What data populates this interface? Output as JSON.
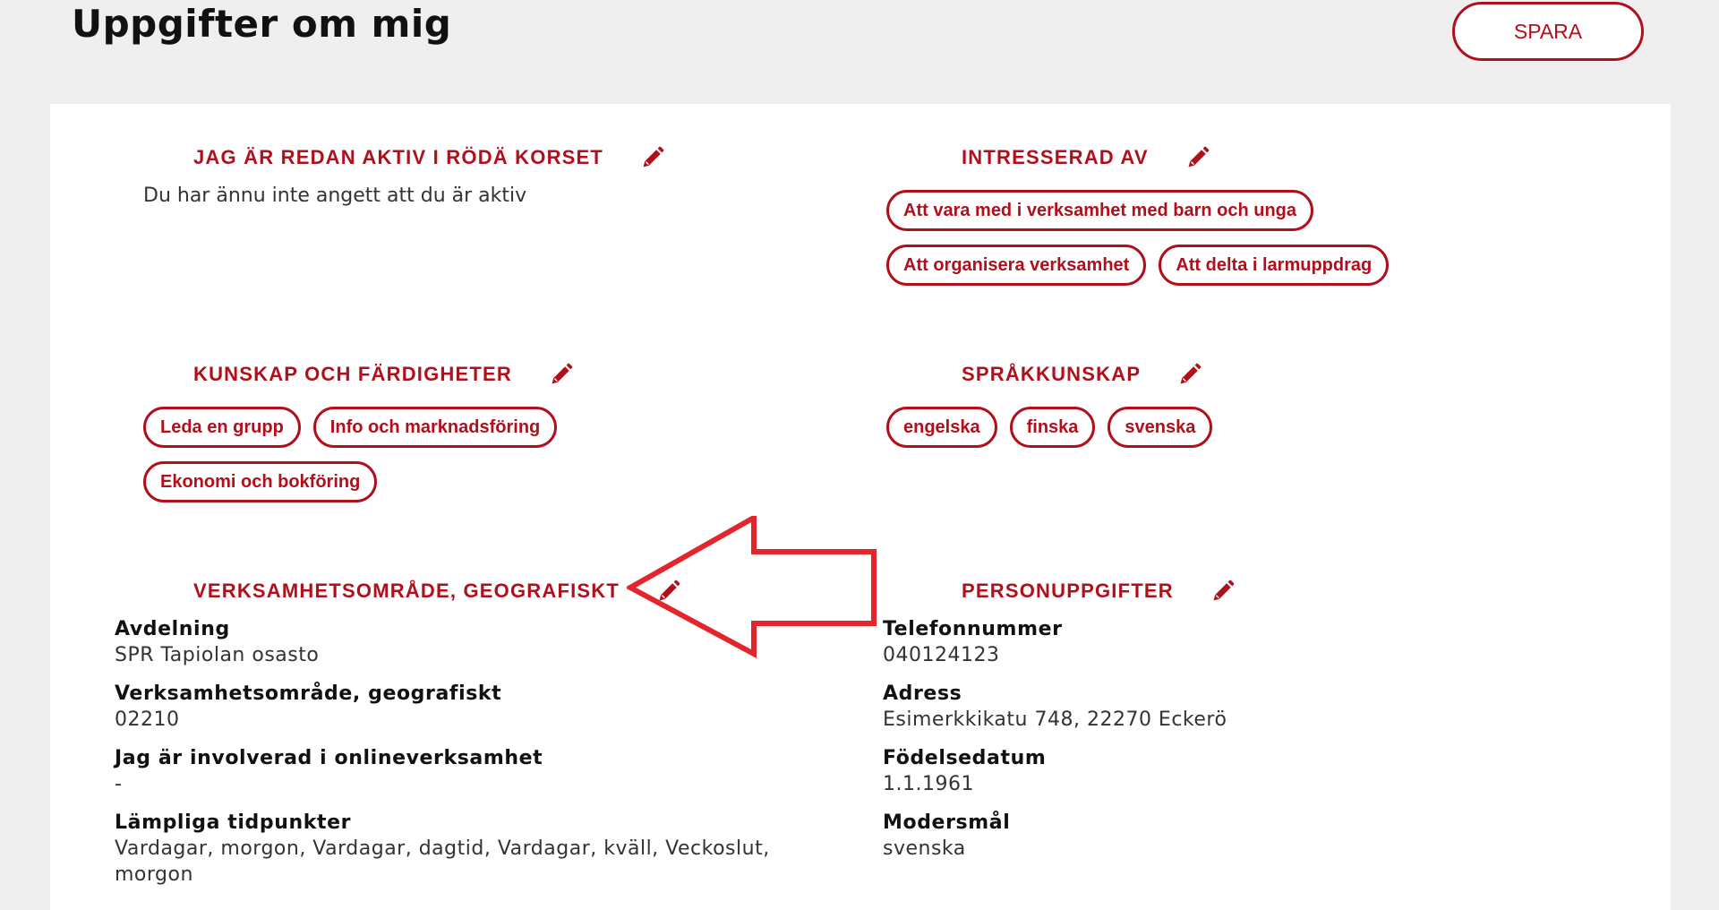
{
  "header": {
    "title": "Uppgifter om mig",
    "save_label": "SPARA"
  },
  "colors": {
    "accent": "#b0101c",
    "annotation_arrow": "#e3262d"
  },
  "sections": {
    "active": {
      "title": "JAG ÄR REDAN AKTIV I RÖDÄ KORSET",
      "text": "Du har ännu inte angett att du är aktiv"
    },
    "interests": {
      "title": "INTRESSERAD AV",
      "chips": [
        "Att vara med i verksamhet med barn och unga",
        "Att organisera verksamhet",
        "Att delta i larmuppdrag"
      ]
    },
    "skills": {
      "title": "KUNSKAP OCH FÄRDIGHETER",
      "chips": [
        "Leda en grupp",
        "Info och marknadsföring",
        "Ekonomi och bokföring"
      ]
    },
    "languages": {
      "title": "SPRÅKKUNSKAP",
      "chips": [
        "engelska",
        "finska",
        "svenska"
      ]
    },
    "area": {
      "title": "VERKSAMHETSOMRÅDE, GEOGRAFISKT",
      "fields": [
        {
          "label": "Avdelning",
          "value": "SPR Tapiolan osasto"
        },
        {
          "label": "Verksamhetsområde, geografiskt",
          "value": "02210"
        },
        {
          "label": "Jag är involverad i onlineverksamhet",
          "value": "-"
        },
        {
          "label": "Lämpliga tidpunkter",
          "value": "Vardagar, morgon, Vardagar, dagtid, Vardagar, kväll, Veckoslut, morgon"
        }
      ]
    },
    "personal": {
      "title": "PERSONUPPGIFTER",
      "fields": [
        {
          "label": "Telefonnummer",
          "value": "040124123"
        },
        {
          "label": "Adress",
          "value": "Esimerkkikatu 748, 22270 Eckerö"
        },
        {
          "label": "Födelsedatum",
          "value": "1.1.1961"
        },
        {
          "label": "Modersmål",
          "value": "svenska"
        }
      ]
    }
  }
}
